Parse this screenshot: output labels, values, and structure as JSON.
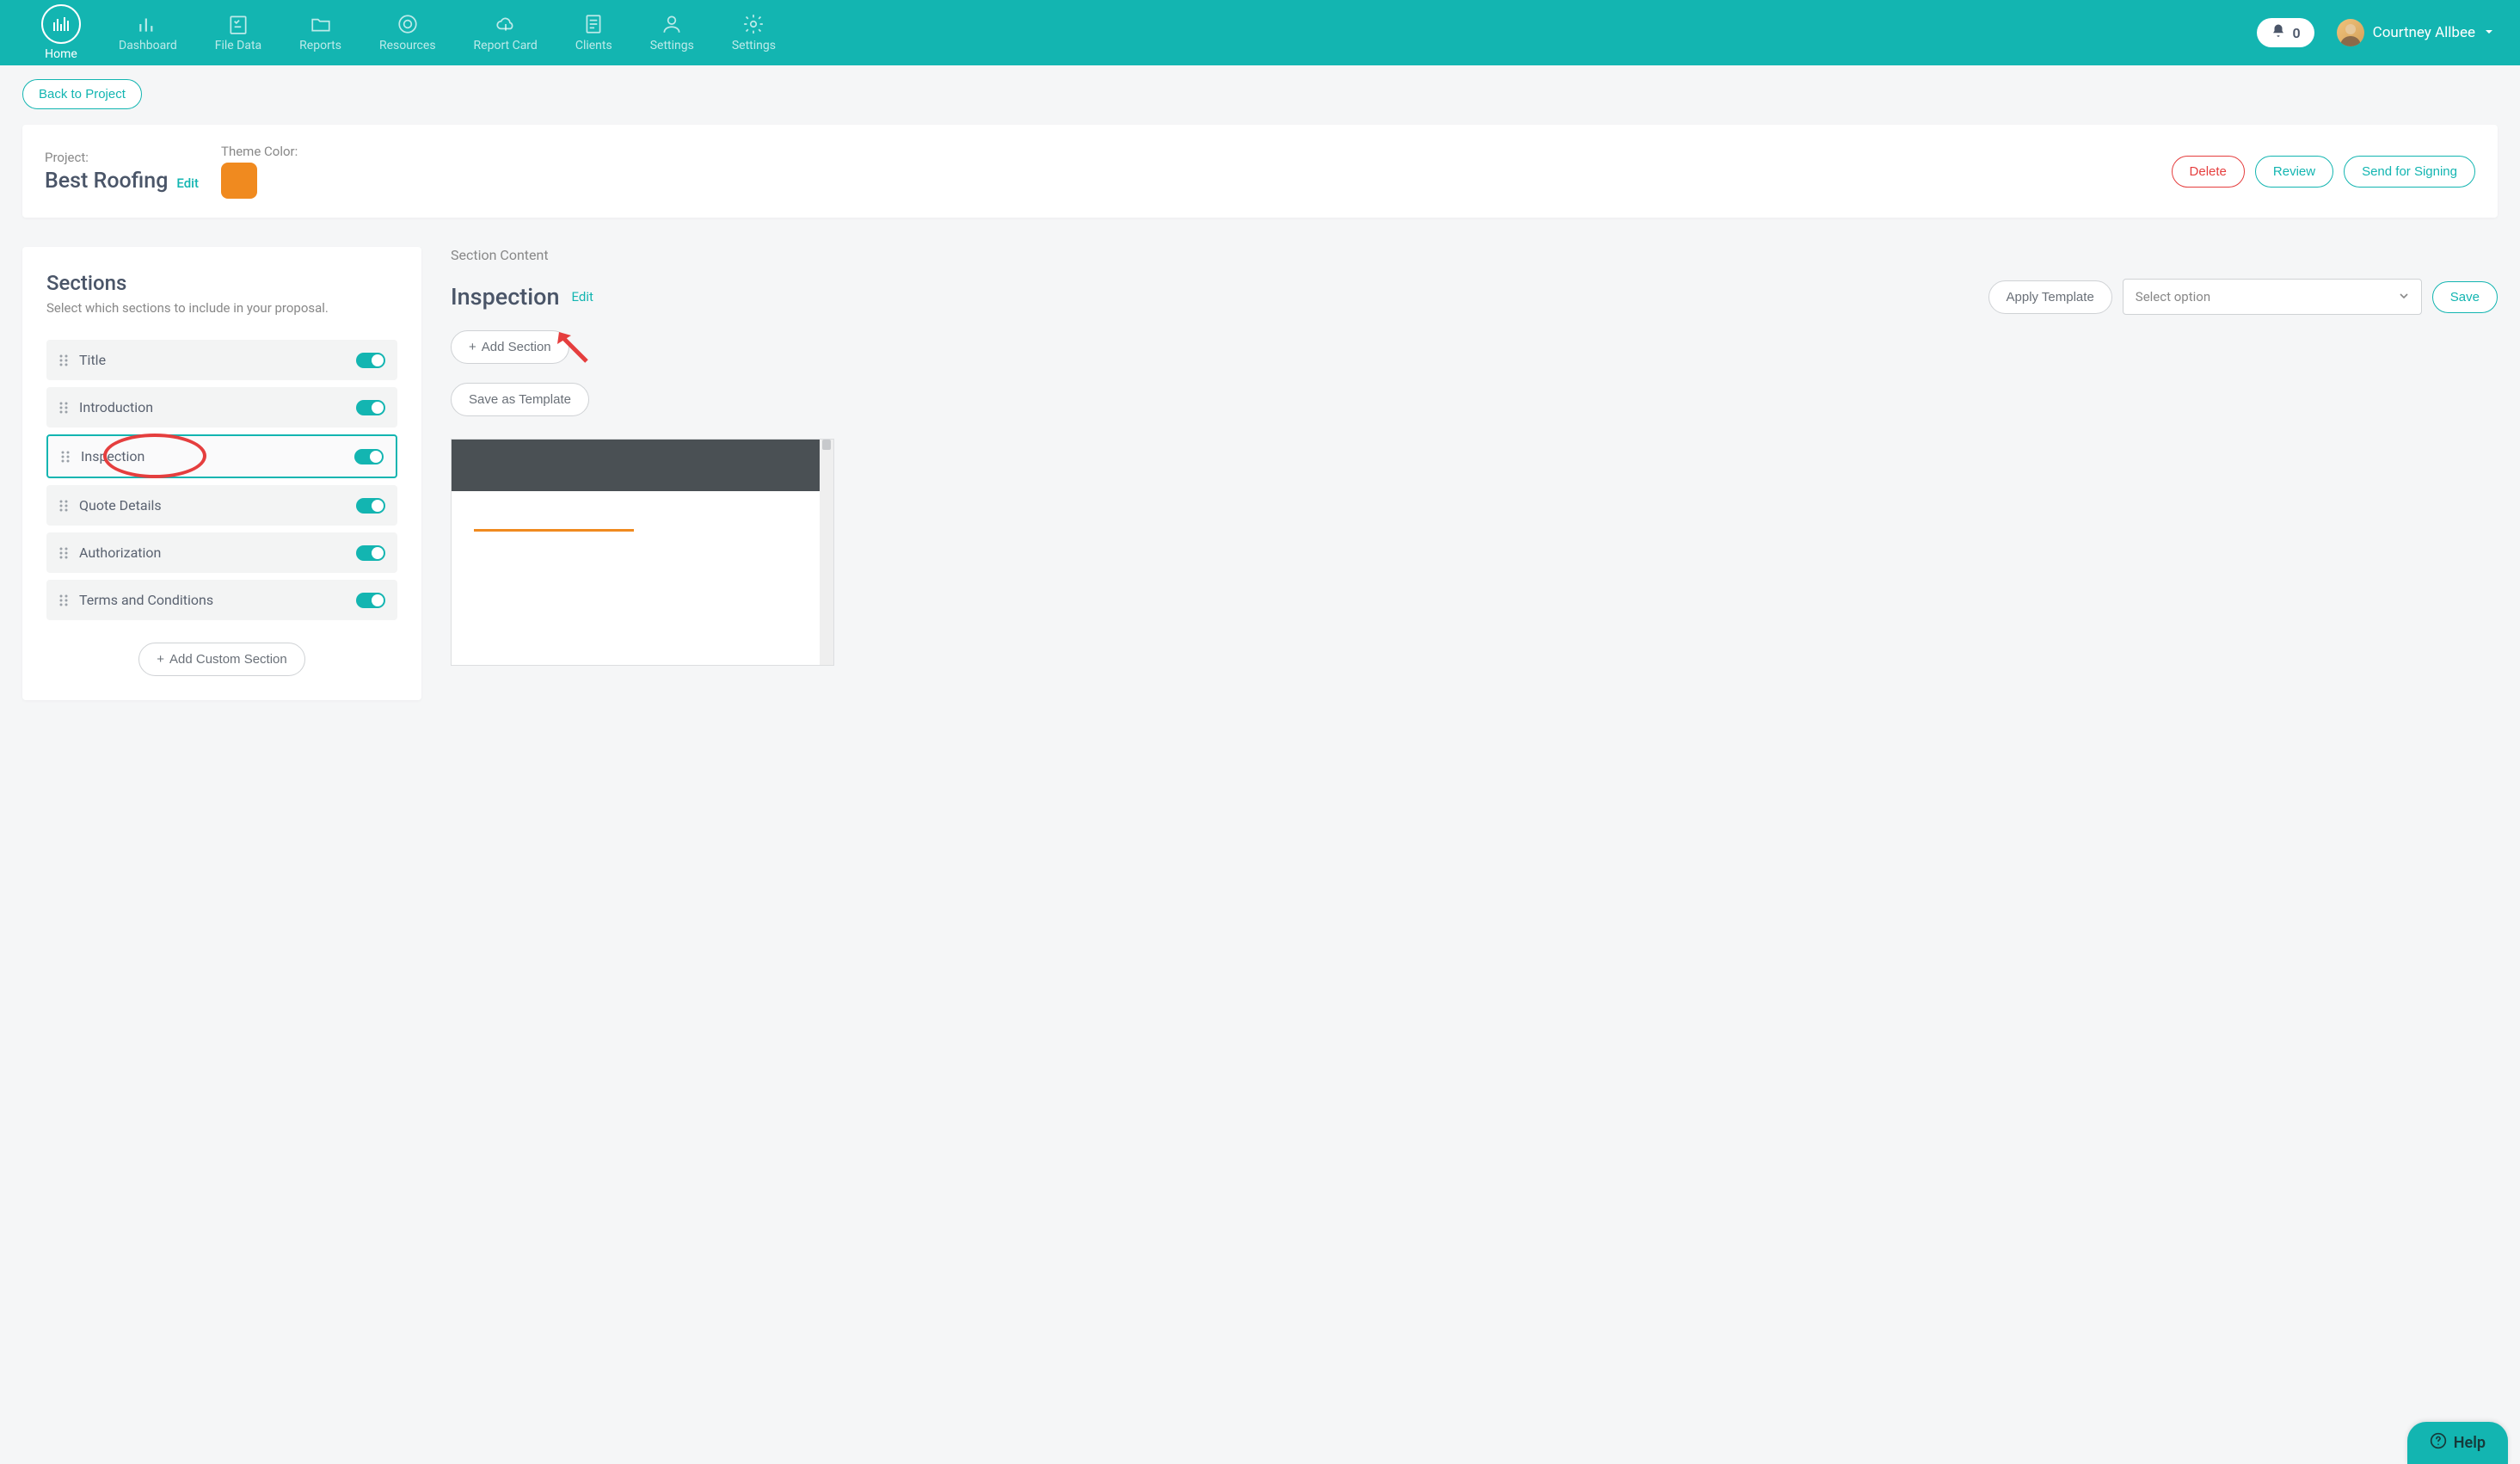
{
  "nav": {
    "items": [
      {
        "label": "Home",
        "icon": "bars"
      },
      {
        "label": "Dashboard",
        "icon": "chart"
      },
      {
        "label": "File Data",
        "icon": "checklist"
      },
      {
        "label": "Reports",
        "icon": "folder"
      },
      {
        "label": "Resources",
        "icon": "target"
      },
      {
        "label": "Report Card",
        "icon": "cloud"
      },
      {
        "label": "Clients",
        "icon": "doc"
      },
      {
        "label": "Settings",
        "icon": "person"
      }
    ],
    "settings_extra": {
      "label": "Settings",
      "icon": "gear"
    },
    "notification_count": "0",
    "user_name": "Courtney Allbee"
  },
  "back_button": "Back to Project",
  "project": {
    "label": "Project:",
    "name": "Best Roofing",
    "edit": "Edit",
    "theme_label": "Theme Color:",
    "theme_color": "#f08a1f",
    "actions": {
      "delete": "Delete",
      "review": "Review",
      "send": "Send for Signing"
    }
  },
  "sections_panel": {
    "title": "Sections",
    "subtitle": "Select which sections to include in your proposal.",
    "items": [
      {
        "name": "Title",
        "enabled": true,
        "selected": false
      },
      {
        "name": "Introduction",
        "enabled": true,
        "selected": false
      },
      {
        "name": "Inspection",
        "enabled": true,
        "selected": true
      },
      {
        "name": "Quote Details",
        "enabled": true,
        "selected": false
      },
      {
        "name": "Authorization",
        "enabled": true,
        "selected": false
      },
      {
        "name": "Terms and Conditions",
        "enabled": true,
        "selected": false
      }
    ],
    "add_custom": "Add Custom Section"
  },
  "content": {
    "label": "Section Content",
    "title": "Inspection",
    "edit": "Edit",
    "apply_template": "Apply Template",
    "select_placeholder": "Select option",
    "save": "Save",
    "add_section": "Add Section",
    "save_as_template": "Save as Template"
  },
  "help": "Help"
}
